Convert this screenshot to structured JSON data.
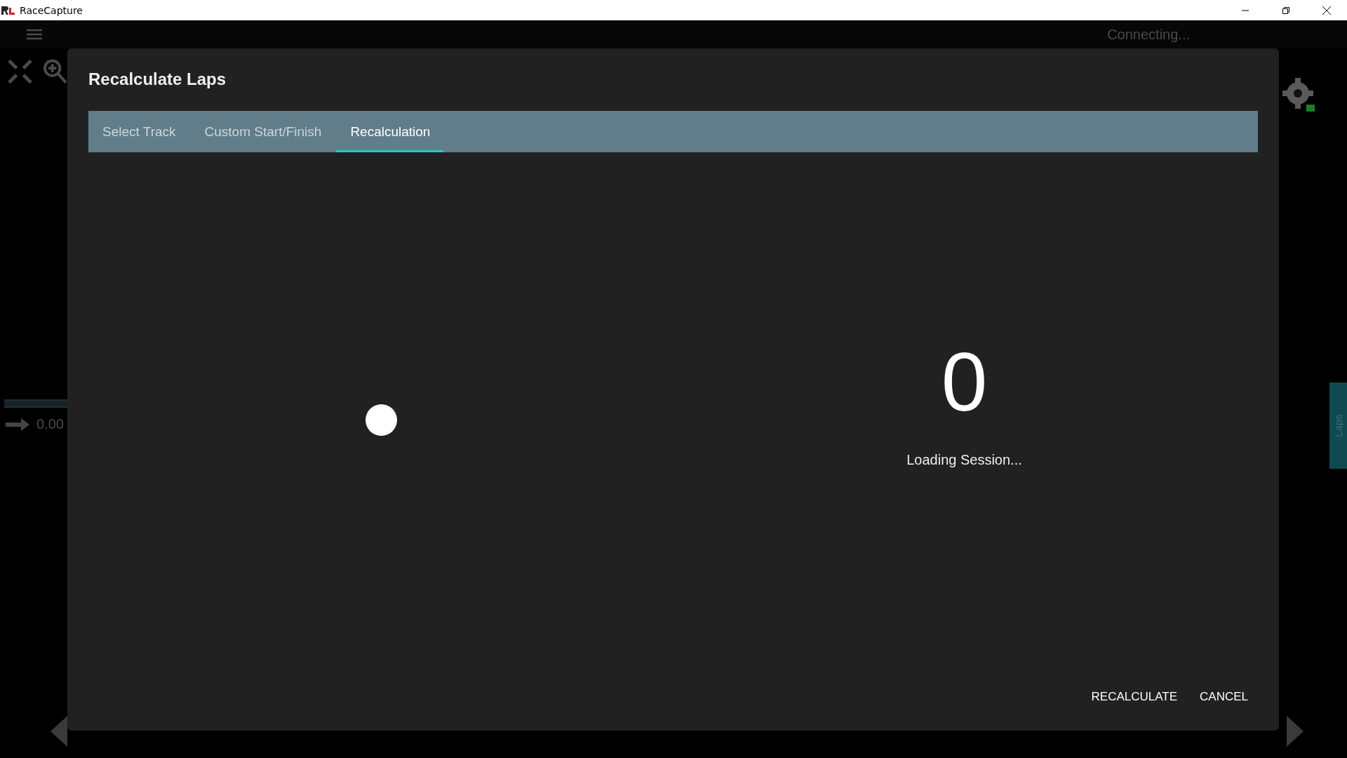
{
  "window": {
    "title": "RaceCapture"
  },
  "app": {
    "status": "Connecting...",
    "readout": "0.00",
    "side_tab": "Laps"
  },
  "dialog": {
    "title": "Recalculate Laps",
    "tabs": [
      {
        "label": "Select Track",
        "selected": false
      },
      {
        "label": "Custom Start/Finish",
        "selected": false
      },
      {
        "label": "Recalculation",
        "selected": true
      }
    ],
    "count": "0",
    "message": "Loading Session...",
    "buttons": [
      "RECALCULATE",
      "CANCEL"
    ]
  }
}
